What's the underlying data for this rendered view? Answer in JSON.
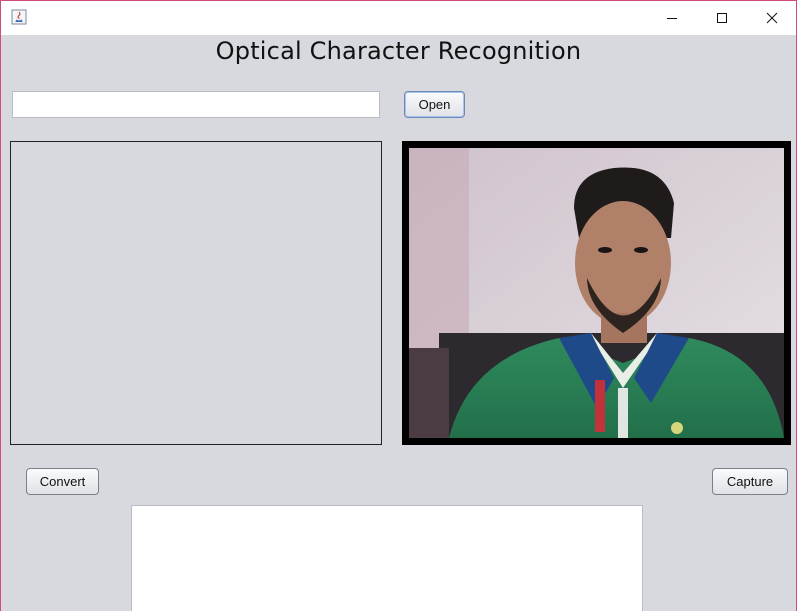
{
  "window": {
    "title": "",
    "controls": {
      "minimize_icon": "minimize-icon",
      "maximize_icon": "maximize-icon",
      "close_icon": "close-icon"
    }
  },
  "header": {
    "title": "Optical Character Recognition"
  },
  "file": {
    "path_value": "",
    "open_label": "Open"
  },
  "actions": {
    "convert_label": "Convert",
    "capture_label": "Capture"
  },
  "output": {
    "text": ""
  },
  "colors": {
    "background": "#d7d9df",
    "border_accent": "#d04a7a"
  }
}
